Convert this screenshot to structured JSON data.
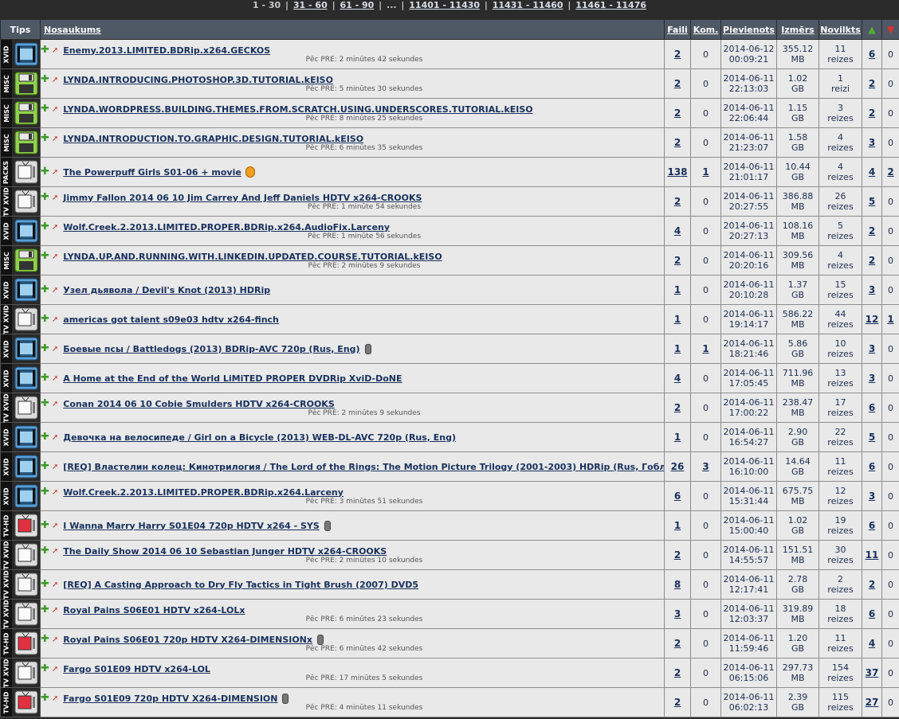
{
  "pager": {
    "current": "1 - 30",
    "links": [
      "31 - 60",
      "61 - 90"
    ],
    "ellipsis": "...",
    "links_end": [
      "11401 - 11430",
      "11431 - 11460",
      "11461 - 11476"
    ],
    "separator": "|"
  },
  "columns": {
    "type": "Tips",
    "name": "Nosaukums",
    "files": "Faili",
    "comments": "Kom.",
    "added": "Pievienots",
    "size": "Izmērs",
    "downloaded": "Novilkts",
    "seeders_icon": "up-triangle-icon",
    "leechers_icon": "down-triangle-icon"
  },
  "colors": {
    "header_bg": "#4f5865",
    "row_bg": "#e9e9e9",
    "link": "#17305c",
    "page_bg": "#2b2b2b"
  },
  "rows": [
    {
      "type": "XVID",
      "icon": "film-icon",
      "title": "Enemy.2013.LIMITED.BDRip.x264.GECKOS",
      "pre": "Pēc PRE: 2 minūtes 42 sekundes",
      "badge": "",
      "files": "2",
      "comments": "0",
      "date": "2014-06-12",
      "time": "00:09:21",
      "size": "355.12",
      "unit": "MB",
      "dl": "11",
      "dlunit": "reizes",
      "seed": "6",
      "leech": "0"
    },
    {
      "type": "MISC",
      "icon": "floppy-icon",
      "title": "LYNDA.INTRODUCING.PHOTOSHOP.3D.TUTORIAL.kEISO",
      "pre": "Pēc PRE: 5 minūtes 30 sekundes",
      "badge": "",
      "files": "2",
      "comments": "0",
      "date": "2014-06-11",
      "time": "22:13:03",
      "size": "1.02",
      "unit": "GB",
      "dl": "1",
      "dlunit": "reizi",
      "seed": "2",
      "leech": "0"
    },
    {
      "type": "MISC",
      "icon": "floppy-icon",
      "title": "LYNDA.WORDPRESS.BUILDING.THEMES.FROM.SCRATCH.USING.UNDERSCORES.TUTORIAL.kEISO",
      "pre": "Pēc PRE: 8 minūtes 25 sekundes",
      "badge": "",
      "files": "2",
      "comments": "0",
      "date": "2014-06-11",
      "time": "22:06:44",
      "size": "1.15",
      "unit": "GB",
      "dl": "3",
      "dlunit": "reizes",
      "seed": "2",
      "leech": "0"
    },
    {
      "type": "MISC",
      "icon": "floppy-icon",
      "title": "LYNDA.INTRODUCTION.TO.GRAPHIC.DESIGN.TUTORIAL.kEISO",
      "pre": "Pēc PRE: 6 minūtes 35 sekundes",
      "badge": "",
      "files": "2",
      "comments": "0",
      "date": "2014-06-11",
      "time": "21:23:07",
      "size": "1.58",
      "unit": "GB",
      "dl": "4",
      "dlunit": "reizes",
      "seed": "3",
      "leech": "0"
    },
    {
      "type": "PACKS",
      "icon": "tv-icon",
      "title": "The Powerpuff Girls S01-06 + movie",
      "pre": "",
      "badge": "coin",
      "files": "138",
      "comments": "1",
      "date": "2014-06-11",
      "time": "21:01:17",
      "size": "10.44",
      "unit": "GB",
      "dl": "4",
      "dlunit": "reizes",
      "seed": "4",
      "leech": "2"
    },
    {
      "type": "TV XVID",
      "icon": "tv-icon",
      "title": "Jimmy Fallon 2014 06 10 Jim Carrey And Jeff Daniels HDTV x264-CROOKS",
      "pre": "Pēc PRE: 1 minūte 54 sekundes",
      "badge": "",
      "files": "2",
      "comments": "0",
      "date": "2014-06-11",
      "time": "20:27:55",
      "size": "386.88",
      "unit": "MB",
      "dl": "26",
      "dlunit": "reizes",
      "seed": "5",
      "leech": "0"
    },
    {
      "type": "XVID",
      "icon": "film-icon",
      "title": "Wolf.Creek.2.2013.LIMITED.PROPER.BDRip.x264.AudioFix.Larceny",
      "pre": "Pēc PRE: 1 minūte 56 sekundes",
      "badge": "",
      "files": "4",
      "comments": "0",
      "date": "2014-06-11",
      "time": "20:27:13",
      "size": "108.16",
      "unit": "MB",
      "dl": "5",
      "dlunit": "reizes",
      "seed": "2",
      "leech": "0"
    },
    {
      "type": "MISC",
      "icon": "floppy-icon",
      "title": "LYNDA.UP.AND.RUNNING.WITH.LINKEDIN.UPDATED.COURSE.TUTORIAL.kEISO",
      "pre": "Pēc PRE: 2 minūtes 9 sekundes",
      "badge": "",
      "files": "2",
      "comments": "0",
      "date": "2014-06-11",
      "time": "20:20:16",
      "size": "309.56",
      "unit": "MB",
      "dl": "4",
      "dlunit": "reizes",
      "seed": "2",
      "leech": "0"
    },
    {
      "type": "XVID",
      "icon": "film-icon",
      "title": "Узел дьявола / Devil's Knot (2013) HDRip",
      "pre": "",
      "badge": "",
      "files": "1",
      "comments": "0",
      "date": "2014-06-11",
      "time": "20:10:28",
      "size": "1.37",
      "unit": "GB",
      "dl": "15",
      "dlunit": "reizes",
      "seed": "3",
      "leech": "0"
    },
    {
      "type": "TV XVID",
      "icon": "tv-icon",
      "title": "americas got talent s09e03 hdtv x264-finch",
      "pre": "",
      "badge": "",
      "files": "1",
      "comments": "0",
      "date": "2014-06-11",
      "time": "19:14:17",
      "size": "586.22",
      "unit": "MB",
      "dl": "44",
      "dlunit": "reizes",
      "seed": "12",
      "leech": "1"
    },
    {
      "type": "XVID",
      "icon": "film-icon",
      "title": "Боевые псы / Battledogs (2013) BDRip-AVC 720p (Rus, Eng)",
      "pre": "",
      "badge": "mic",
      "files": "1",
      "comments": "1",
      "date": "2014-06-11",
      "time": "18:21:46",
      "size": "5.86",
      "unit": "GB",
      "dl": "10",
      "dlunit": "reizes",
      "seed": "3",
      "leech": "0"
    },
    {
      "type": "XVID",
      "icon": "film-icon",
      "title": "A Home at the End of the World LiMiTED PROPER DVDRip XviD-DoNE",
      "pre": "",
      "badge": "",
      "files": "4",
      "comments": "0",
      "date": "2014-06-11",
      "time": "17:05:45",
      "size": "711.96",
      "unit": "MB",
      "dl": "13",
      "dlunit": "reizes",
      "seed": "3",
      "leech": "0"
    },
    {
      "type": "TV XVID",
      "icon": "tv-icon",
      "title": "Conan 2014 06 10 Cobie Smulders HDTV x264-CROOKS",
      "pre": "Pēc PRE: 2 minūtes 9 sekundes",
      "badge": "",
      "files": "2",
      "comments": "0",
      "date": "2014-06-11",
      "time": "17:00:22",
      "size": "238.47",
      "unit": "MB",
      "dl": "17",
      "dlunit": "reizes",
      "seed": "6",
      "leech": "0"
    },
    {
      "type": "XVID",
      "icon": "film-icon",
      "title": "Девочка на велосипеде / Girl on a Bicycle (2013) WEB-DL-AVC 720p (Rus, Eng)",
      "pre": "",
      "badge": "",
      "files": "1",
      "comments": "0",
      "date": "2014-06-11",
      "time": "16:54:27",
      "size": "2.90",
      "unit": "GB",
      "dl": "22",
      "dlunit": "reizes",
      "seed": "5",
      "leech": "0"
    },
    {
      "type": "XVID",
      "icon": "film-icon",
      "title": "[REQ] Властелин колец: Кинотрилогия / The Lord of the Rings: The Motion Picture Trilogy (2001-2003) HDRip (Rus, Гоблин, Eng)",
      "pre": "",
      "badge": "coin",
      "files": "26",
      "comments": "3",
      "date": "2014-06-11",
      "time": "16:10:00",
      "size": "14.64",
      "unit": "GB",
      "dl": "11",
      "dlunit": "reizes",
      "seed": "6",
      "leech": "0"
    },
    {
      "type": "XVID",
      "icon": "film-icon",
      "title": "Wolf.Creek.2.2013.LIMITED.PROPER.BDRip.x264.Larceny",
      "pre": "Pēc PRE: 3 minūtes 51 sekundes",
      "badge": "",
      "files": "6",
      "comments": "0",
      "date": "2014-06-11",
      "time": "15:31:44",
      "size": "675.75",
      "unit": "MB",
      "dl": "12",
      "dlunit": "reizes",
      "seed": "3",
      "leech": "0"
    },
    {
      "type": "TV-HD",
      "icon": "tv-red-icon",
      "title": "I Wanna Marry Harry S01E04 720p HDTV x264 - SYS",
      "pre": "",
      "badge": "mic",
      "files": "1",
      "comments": "0",
      "date": "2014-06-11",
      "time": "15:00:40",
      "size": "1.02",
      "unit": "GB",
      "dl": "19",
      "dlunit": "reizes",
      "seed": "6",
      "leech": "0"
    },
    {
      "type": "TV XVID",
      "icon": "tv-icon",
      "title": "The Daily Show 2014 06 10 Sebastian Junger HDTV x264-CROOKS",
      "pre": "Pēc PRE: 2 minūtes 10 sekundes",
      "badge": "",
      "files": "2",
      "comments": "0",
      "date": "2014-06-11",
      "time": "14:55:57",
      "size": "151.51",
      "unit": "MB",
      "dl": "30",
      "dlunit": "reizes",
      "seed": "11",
      "leech": "0"
    },
    {
      "type": "TV XVID",
      "icon": "tv-icon",
      "title": "[REQ] A Casting Approach to Dry Fly Tactics in Tight Brush (2007) DVD5",
      "pre": "",
      "badge": "",
      "files": "8",
      "comments": "0",
      "date": "2014-06-11",
      "time": "12:17:41",
      "size": "2.78",
      "unit": "GB",
      "dl": "2",
      "dlunit": "reizes",
      "seed": "2",
      "leech": "0"
    },
    {
      "type": "TV XVID",
      "icon": "tv-icon",
      "title": "Royal Pains S06E01 HDTV x264-LOLx",
      "pre": "Pēc PRE: 6 minūtes 23 sekundes",
      "badge": "",
      "files": "3",
      "comments": "0",
      "date": "2014-06-11",
      "time": "12:03:37",
      "size": "319.89",
      "unit": "MB",
      "dl": "18",
      "dlunit": "reizes",
      "seed": "6",
      "leech": "0"
    },
    {
      "type": "TV-HD",
      "icon": "tv-red-icon",
      "title": "Royal Pains S06E01 720p HDTV X264-DIMENSIONx",
      "pre": "Pēc PRE: 6 minūtes 42 sekundes",
      "badge": "mic",
      "files": "2",
      "comments": "0",
      "date": "2014-06-11",
      "time": "11:59:46",
      "size": "1.20",
      "unit": "GB",
      "dl": "11",
      "dlunit": "reizes",
      "seed": "4",
      "leech": "0"
    },
    {
      "type": "TV XVID",
      "icon": "tv-icon",
      "title": "Fargo S01E09 HDTV x264-LOL",
      "pre": "Pēc PRE: 17 minūtes 5 sekundes",
      "badge": "",
      "files": "2",
      "comments": "0",
      "date": "2014-06-11",
      "time": "06:15:06",
      "size": "297.73",
      "unit": "MB",
      "dl": "154",
      "dlunit": "reizes",
      "seed": "37",
      "leech": "0"
    },
    {
      "type": "TV-HD",
      "icon": "tv-red-icon",
      "title": "Fargo S01E09 720p HDTV X264-DIMENSION",
      "pre": "Pēc PRE: 4 minūtes 11 sekundes",
      "badge": "mic",
      "files": "2",
      "comments": "0",
      "date": "2014-06-11",
      "time": "06:02:13",
      "size": "2.39",
      "unit": "GB",
      "dl": "115",
      "dlunit": "reizes",
      "seed": "27",
      "leech": "0"
    }
  ]
}
